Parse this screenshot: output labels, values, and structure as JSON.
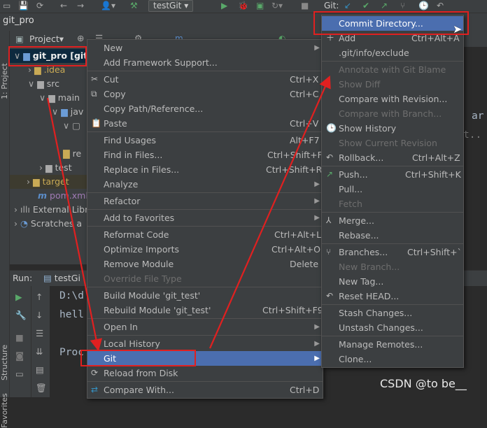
{
  "toolbar": {
    "run_config": "testGit",
    "git_label": "Git:"
  },
  "breadcrumb": {
    "project": "git_pro"
  },
  "side_strip": {
    "project": "1: Project",
    "structure": "Structure",
    "favorites": "Favorites"
  },
  "project_panel": {
    "header": "Project",
    "items": [
      {
        "label": "git_pro [git",
        "kind": "module"
      },
      {
        "label": ".idea",
        "kind": "folder-ignored"
      },
      {
        "label": "src",
        "kind": "folder"
      },
      {
        "label": "main",
        "kind": "folder"
      },
      {
        "label": "jav",
        "kind": "folder-blue"
      },
      {
        "label": "re",
        "kind": "file"
      },
      {
        "label": "test",
        "kind": "folder"
      },
      {
        "label": "target",
        "kind": "folder-ignored"
      },
      {
        "label": "pom.xml",
        "kind": "maven"
      },
      {
        "label": "External Libr",
        "kind": "library"
      },
      {
        "label": "Scratches a",
        "kind": "scratches"
      }
    ]
  },
  "run_panel": {
    "label": "Run:",
    "tab": "testGi",
    "console_lines": [
      "D:\\d",
      "hell",
      "",
      "Proc"
    ]
  },
  "editor_text": [
    "ar",
    "t.."
  ],
  "context_menu": {
    "items": [
      {
        "label": "New",
        "shortcut": "",
        "submenu": true,
        "disabled": false
      },
      {
        "label": "Add Framework Support...",
        "shortcut": "",
        "submenu": false,
        "disabled": false
      },
      {
        "label": "Cut",
        "shortcut": "Ctrl+X",
        "submenu": false,
        "disabled": false,
        "icon": "cut-icon"
      },
      {
        "label": "Copy",
        "shortcut": "Ctrl+C",
        "submenu": false,
        "disabled": false,
        "icon": "copy-icon"
      },
      {
        "label": "Copy Path/Reference...",
        "shortcut": "",
        "submenu": false,
        "disabled": false
      },
      {
        "label": "Paste",
        "shortcut": "Ctrl+V",
        "submenu": false,
        "disabled": false,
        "icon": "paste-icon"
      },
      {
        "label": "Find Usages",
        "shortcut": "Alt+F7",
        "submenu": false,
        "disabled": false
      },
      {
        "label": "Find in Files...",
        "shortcut": "Ctrl+Shift+F",
        "submenu": false,
        "disabled": false
      },
      {
        "label": "Replace in Files...",
        "shortcut": "Ctrl+Shift+R",
        "submenu": false,
        "disabled": false
      },
      {
        "label": "Analyze",
        "shortcut": "",
        "submenu": true,
        "disabled": false
      },
      {
        "label": "Refactor",
        "shortcut": "",
        "submenu": true,
        "disabled": false
      },
      {
        "label": "Add to Favorites",
        "shortcut": "",
        "submenu": true,
        "disabled": false
      },
      {
        "label": "Reformat Code",
        "shortcut": "Ctrl+Alt+L",
        "submenu": false,
        "disabled": false
      },
      {
        "label": "Optimize Imports",
        "shortcut": "Ctrl+Alt+O",
        "submenu": false,
        "disabled": false
      },
      {
        "label": "Remove Module",
        "shortcut": "Delete",
        "submenu": false,
        "disabled": false
      },
      {
        "label": "Override File Type",
        "shortcut": "",
        "submenu": false,
        "disabled": true
      },
      {
        "label": "Build Module 'git_test'",
        "shortcut": "",
        "submenu": false,
        "disabled": false
      },
      {
        "label": "Rebuild Module 'git_test'",
        "shortcut": "Ctrl+Shift+F9",
        "submenu": false,
        "disabled": false
      },
      {
        "label": "Open In",
        "shortcut": "",
        "submenu": true,
        "disabled": false
      },
      {
        "label": "Local History",
        "shortcut": "",
        "submenu": true,
        "disabled": false
      },
      {
        "label": "Git",
        "shortcut": "",
        "submenu": true,
        "disabled": false,
        "highlighted": true
      },
      {
        "label": "Reload from Disk",
        "shortcut": "",
        "submenu": false,
        "disabled": false,
        "icon": "reload-icon"
      },
      {
        "label": "Compare With...",
        "shortcut": "Ctrl+D",
        "submenu": false,
        "disabled": false,
        "icon": "compare-icon"
      }
    ]
  },
  "git_submenu": {
    "items": [
      {
        "label": "Commit Directory...",
        "shortcut": "",
        "disabled": false,
        "highlighted": true
      },
      {
        "label": "Add",
        "shortcut": "Ctrl+Alt+A",
        "disabled": false,
        "icon": "plus-icon"
      },
      {
        "label": ".git/info/exclude",
        "shortcut": "",
        "disabled": false
      },
      {
        "label": "Annotate with Git Blame",
        "shortcut": "",
        "disabled": true
      },
      {
        "label": "Show Diff",
        "shortcut": "",
        "disabled": true
      },
      {
        "label": "Compare with Revision...",
        "shortcut": "",
        "disabled": false
      },
      {
        "label": "Compare with Branch...",
        "shortcut": "",
        "disabled": true
      },
      {
        "label": "Show History",
        "shortcut": "",
        "disabled": false,
        "icon": "history-icon"
      },
      {
        "label": "Show Current Revision",
        "shortcut": "",
        "disabled": true
      },
      {
        "label": "Rollback...",
        "shortcut": "Ctrl+Alt+Z",
        "disabled": false,
        "icon": "rollback-icon"
      },
      {
        "label": "Push...",
        "shortcut": "Ctrl+Shift+K",
        "disabled": false,
        "icon": "push-icon"
      },
      {
        "label": "Pull...",
        "shortcut": "",
        "disabled": false
      },
      {
        "label": "Fetch",
        "shortcut": "",
        "disabled": true
      },
      {
        "label": "Merge...",
        "shortcut": "",
        "disabled": false,
        "icon": "merge-icon"
      },
      {
        "label": "Rebase...",
        "shortcut": "",
        "disabled": false
      },
      {
        "label": "Branches...",
        "shortcut": "Ctrl+Shift+`",
        "disabled": false,
        "icon": "branch-icon"
      },
      {
        "label": "New Branch...",
        "shortcut": "",
        "disabled": true
      },
      {
        "label": "New Tag...",
        "shortcut": "",
        "disabled": false
      },
      {
        "label": "Reset HEAD...",
        "shortcut": "",
        "disabled": false,
        "icon": "reset-icon"
      },
      {
        "label": "Stash Changes...",
        "shortcut": "",
        "disabled": false
      },
      {
        "label": "Unstash Changes...",
        "shortcut": "",
        "disabled": false
      },
      {
        "label": "Manage Remotes...",
        "shortcut": "",
        "disabled": false
      },
      {
        "label": "Clone...",
        "shortcut": "",
        "disabled": false
      }
    ]
  },
  "watermark": "CSDN @to be__",
  "colors": {
    "highlight": "#4b6eaf",
    "annotation_red": "#e02020",
    "menu_bg": "#3c3f41"
  }
}
